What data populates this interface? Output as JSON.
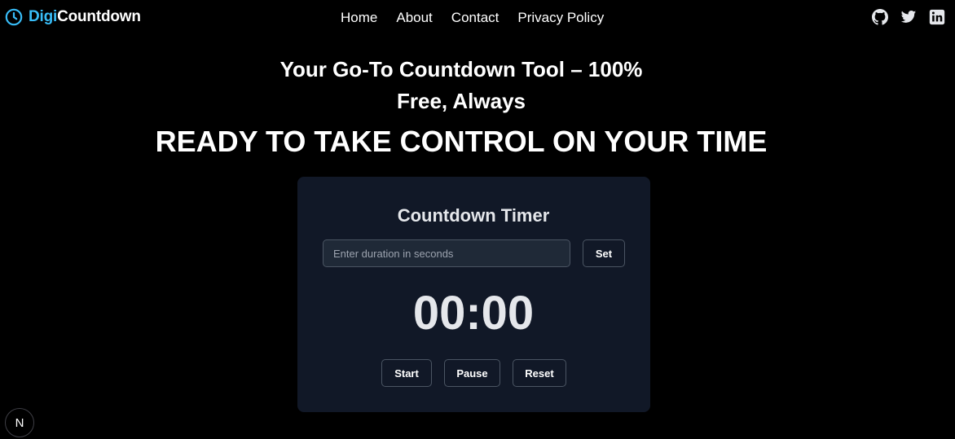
{
  "header": {
    "logo_accent": "Digi",
    "logo_rest": "Countdown",
    "nav": [
      "Home",
      "About",
      "Contact",
      "Privacy Policy"
    ],
    "social_icons": [
      "github-icon",
      "twitter-icon",
      "linkedin-icon"
    ]
  },
  "hero": {
    "line1": "Your Go-To Countdown Tool – 100%",
    "line2": "Free, Always",
    "headline": "READY TO TAKE CONTROL ON YOUR TIME"
  },
  "timer": {
    "title": "Countdown Timer",
    "input_placeholder": "Enter duration in seconds",
    "input_value": "",
    "set_label": "Set",
    "display": "00:00",
    "start_label": "Start",
    "pause_label": "Pause",
    "reset_label": "Reset"
  },
  "badge": {
    "label": "N"
  },
  "colors": {
    "background": "#000000",
    "accent": "#38bdf8",
    "card": "#111827",
    "input_bg": "#1f2937",
    "border": "#4b5563"
  }
}
